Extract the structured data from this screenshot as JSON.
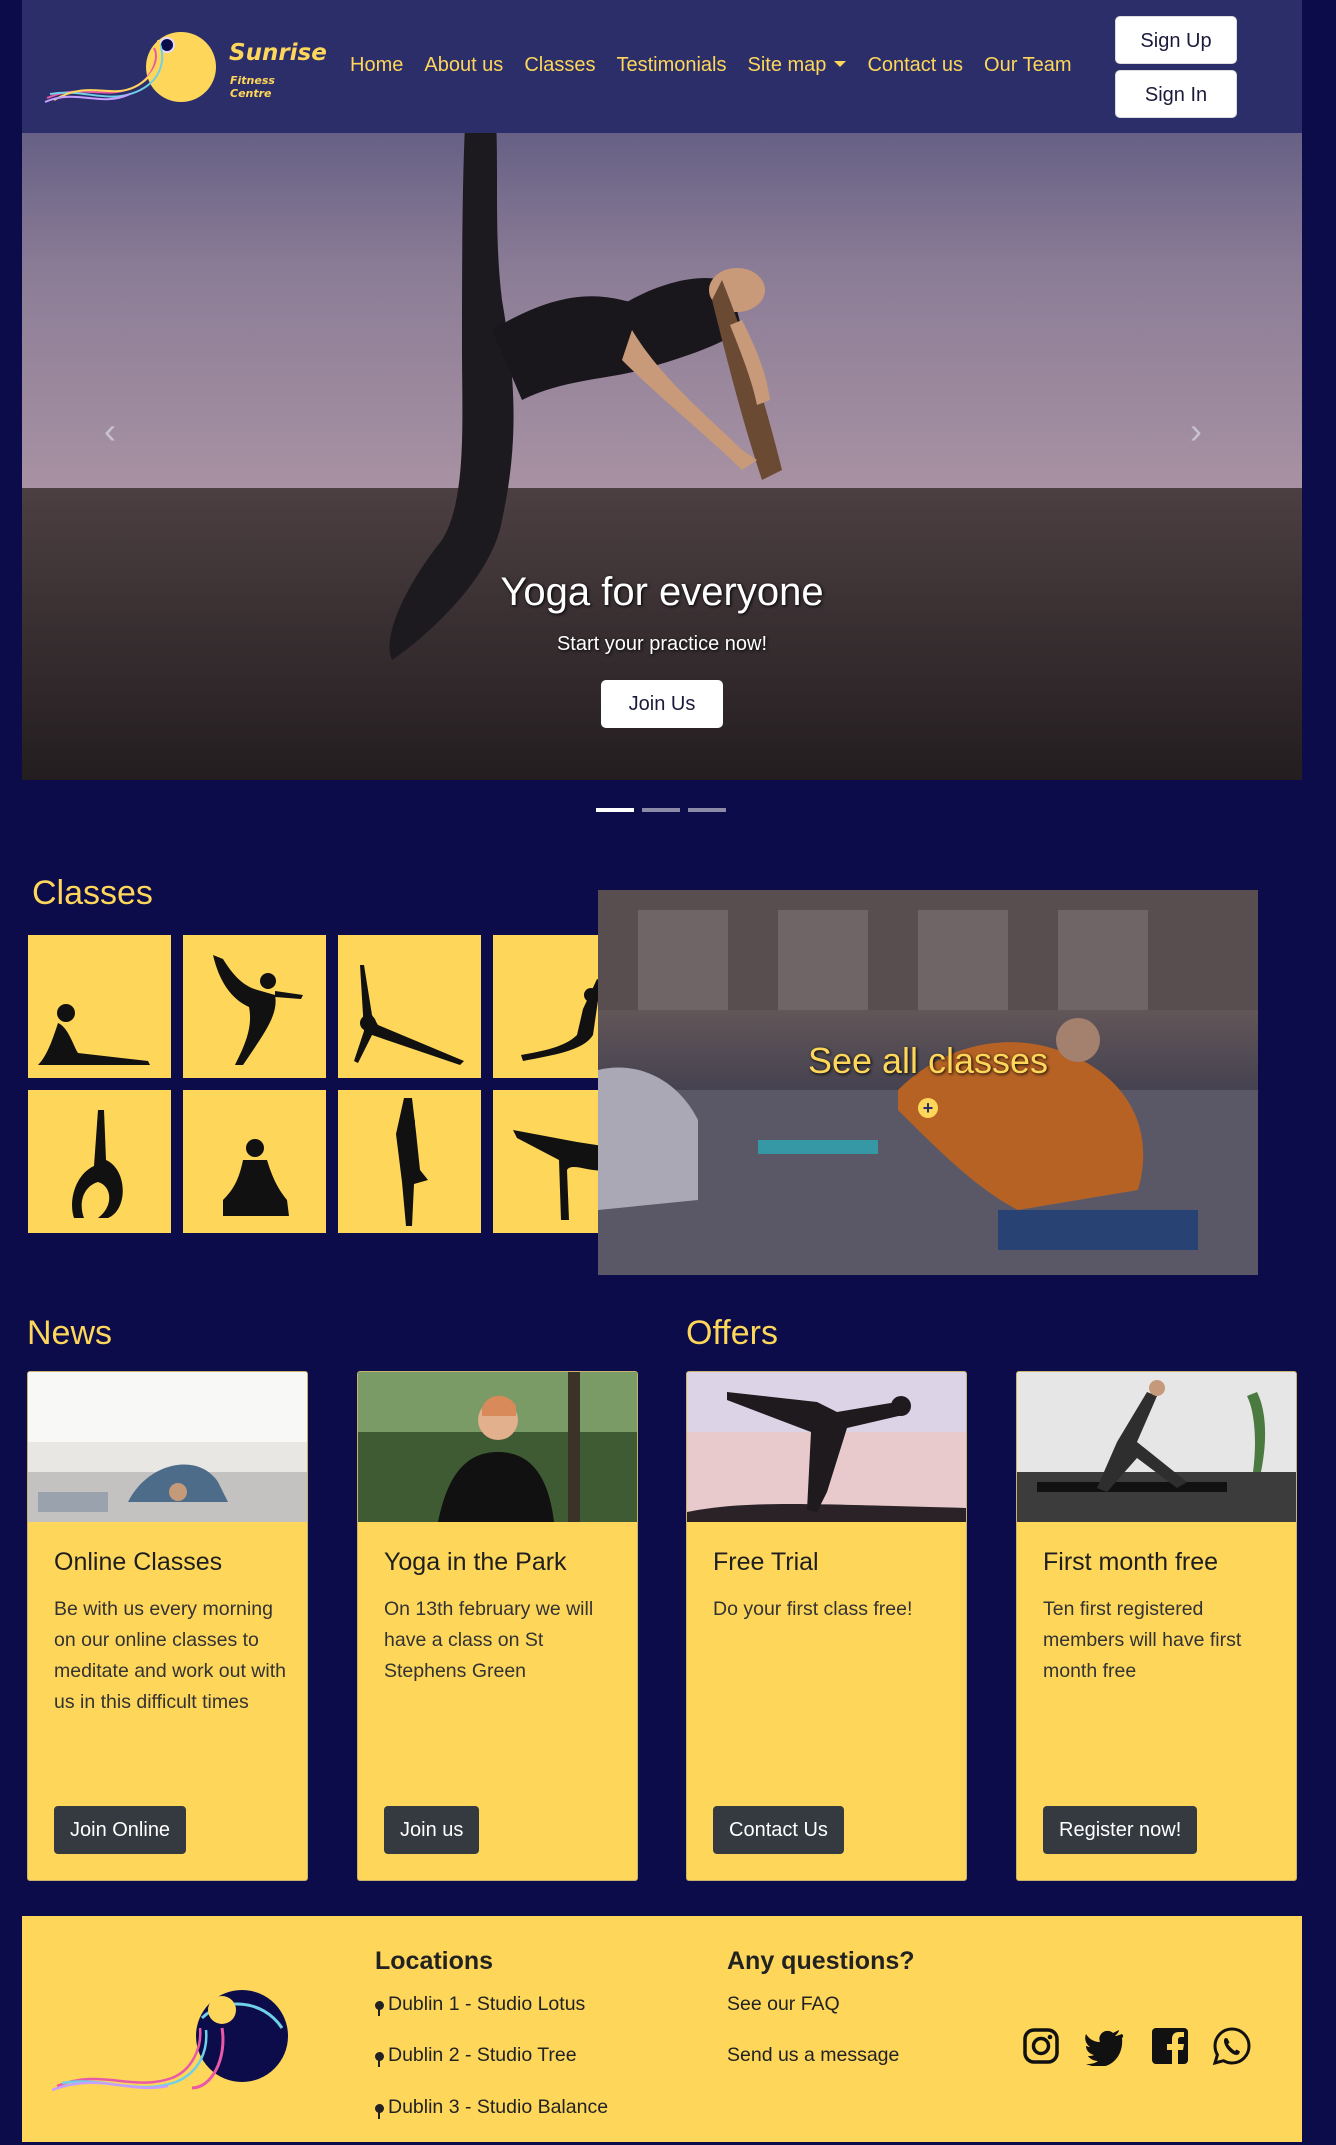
{
  "nav": {
    "brand": "Sunrise",
    "brand_sub": "Fitness Centre",
    "links": [
      "Home",
      "About us",
      "Classes",
      "Testimonials",
      "Site map",
      "Contact us",
      "Our Team"
    ],
    "signup": "Sign Up",
    "signin": "Sign In"
  },
  "hero": {
    "title": "Yoga for everyone",
    "subtitle": "Start your practice now!",
    "button": "Join Us",
    "prev": "‹",
    "next": "›",
    "slides": 3,
    "active_slide": 1
  },
  "classes": {
    "heading": "Classes",
    "see_all": "See all classes",
    "poses": [
      "cobra-pose",
      "dancer-pose",
      "side-plank-pose",
      "mermaid-pose",
      "scorpion-pose",
      "lotus-pose",
      "tree-pose",
      "flying-pose"
    ]
  },
  "news": {
    "heading": "News",
    "cards": [
      {
        "title": "Online Classes",
        "body": "Be with us every morning on our online classes to meditate and work out with us in this difficult times",
        "button": "Join Online"
      },
      {
        "title": "Yoga in the Park",
        "body": "On 13th february we will have a class on St Stephens Green",
        "button": "Join us"
      }
    ]
  },
  "offers": {
    "heading": "Offers",
    "cards": [
      {
        "title": "Free Trial",
        "body": "Do your first class free!",
        "button": "Contact Us"
      },
      {
        "title": "First month free",
        "body": "Ten first registered members will have first month free",
        "button": "Register now!"
      }
    ]
  },
  "footer": {
    "locations_heading": "Locations",
    "locations": [
      "Dublin 1 - Studio Lotus",
      "Dublin 2 - Studio Tree",
      "Dublin 3 - Studio Balance"
    ],
    "questions_heading": "Any questions?",
    "faq": "See our FAQ",
    "message": "Send us a message",
    "social": [
      "instagram-icon",
      "twitter-icon",
      "facebook-icon",
      "whatsapp-icon"
    ]
  },
  "colors": {
    "navy": "#0c0c4a",
    "yellow": "#fdd65a",
    "nav": "#2c2e69"
  }
}
